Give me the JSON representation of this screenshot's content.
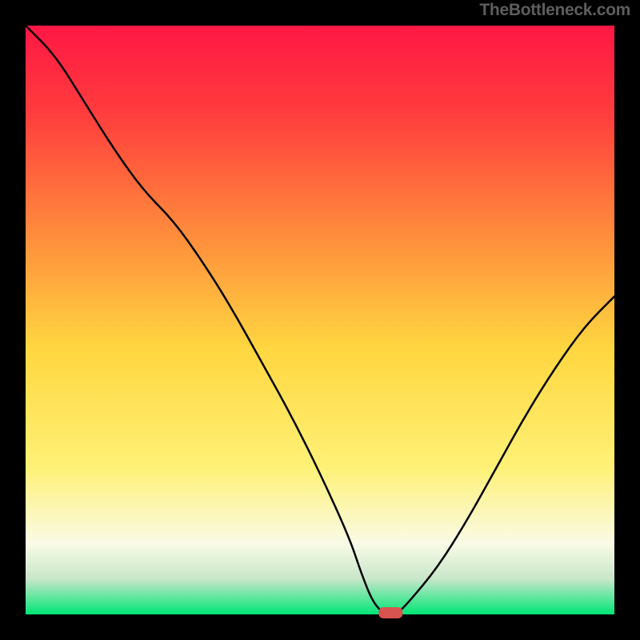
{
  "watermark": "TheBottleneck.com",
  "chart_data": {
    "type": "line",
    "title": "",
    "xlabel": "",
    "ylabel": "",
    "xlim": [
      0,
      100
    ],
    "ylim": [
      0,
      100
    ],
    "x": [
      0,
      5,
      10,
      15,
      20,
      25,
      30,
      35,
      40,
      45,
      50,
      55,
      57,
      59,
      61,
      63,
      65,
      70,
      75,
      80,
      85,
      90,
      95,
      100
    ],
    "values": [
      103,
      95,
      87,
      79,
      72,
      67,
      60,
      52,
      43,
      34,
      24,
      13,
      7,
      2,
      0,
      0,
      2,
      8,
      16,
      25,
      34,
      42,
      49,
      54
    ],
    "minimum_marker": {
      "x": 62,
      "color": "#d9534f"
    },
    "gradient_stops": [
      {
        "offset": 0,
        "color": "#ff1744"
      },
      {
        "offset": 15,
        "color": "#ff3d3d"
      },
      {
        "offset": 35,
        "color": "#ff8a3c"
      },
      {
        "offset": 55,
        "color": "#ffd740"
      },
      {
        "offset": 75,
        "color": "#fff176"
      },
      {
        "offset": 88,
        "color": "#f9fbe7"
      },
      {
        "offset": 94,
        "color": "#c8e6c9"
      },
      {
        "offset": 100,
        "color": "#00e676"
      }
    ],
    "frame_color": "#000000",
    "frame_thickness": 32
  }
}
